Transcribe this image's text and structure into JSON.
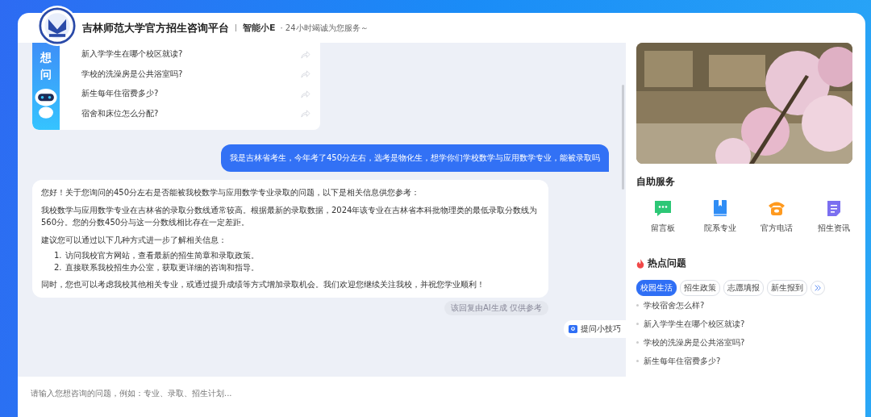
{
  "header": {
    "title": "吉林师范大学官方招生咨询平台",
    "assistant": "智能小E",
    "slogan": "· 24小时竭诚为您服务～"
  },
  "suggest": {
    "vertical_label": "想问",
    "questions": [
      "新入学学生在哪个校区就读?",
      "学校的洗澡房是公共浴室吗?",
      "新生每年住宿费多少?",
      "宿舍和床位怎么分配?"
    ]
  },
  "messages": [
    {
      "kind": "user",
      "text": "我是吉林省考生，今年考了450分左右，选考是物化生，想学你们学校数学与应用数学专业，能被录取吗"
    },
    {
      "kind": "bot",
      "paragraphs": [
        "您好！关于您询问的450分左右是否能被我校数学与应用数学专业录取的问题，以下是相关信息供您参考：",
        "我校数学与应用数学专业在吉林省的录取分数线通常较高。根据最新的录取数据，2024年该专业在吉林省本科批物理类的最低录取分数线为560分。您的分数450分与这一分数线相比存在一定差距。",
        "建议您可以通过以下几种方式进一步了解相关信息："
      ],
      "list": [
        "访问我校官方网站，查看最新的招生简章和录取政策。",
        "直接联系我校招生办公室，获取更详细的咨询和指导。"
      ],
      "closing": "同时，您也可以考虑我校其他相关专业，或通过提升成绩等方式增加录取机会。我们欢迎您继续关注我校，并祝您学业顺利！",
      "list_numbers": [
        "1.",
        "2."
      ]
    }
  ],
  "disclaimer": "该回复由AI生成 仅供参考",
  "tips_button": "提问小技巧",
  "input": {
    "placeholder": "请输入您想咨询的问题，例如：专业、录取、招生计划..."
  },
  "sidebar": {
    "services_title": "自助服务",
    "services": [
      {
        "kind": "message",
        "label": "留言板"
      },
      {
        "kind": "book",
        "label": "院系专业"
      },
      {
        "kind": "phone",
        "label": "官方电话"
      },
      {
        "kind": "doc",
        "label": "招生资讯"
      }
    ],
    "hot_title": "热点问题",
    "tabs": [
      {
        "label": "校园生活",
        "selected": true
      },
      {
        "label": "招生政策",
        "selected": false
      },
      {
        "label": "志愿填报",
        "selected": false
      },
      {
        "label": "新生报到",
        "selected": false
      }
    ],
    "hot_questions": [
      "学校宿舍怎么样?",
      "新入学学生在哪个校区就读?",
      "学校的洗澡房是公共浴室吗?",
      "新生每年住宿费多少?"
    ]
  }
}
